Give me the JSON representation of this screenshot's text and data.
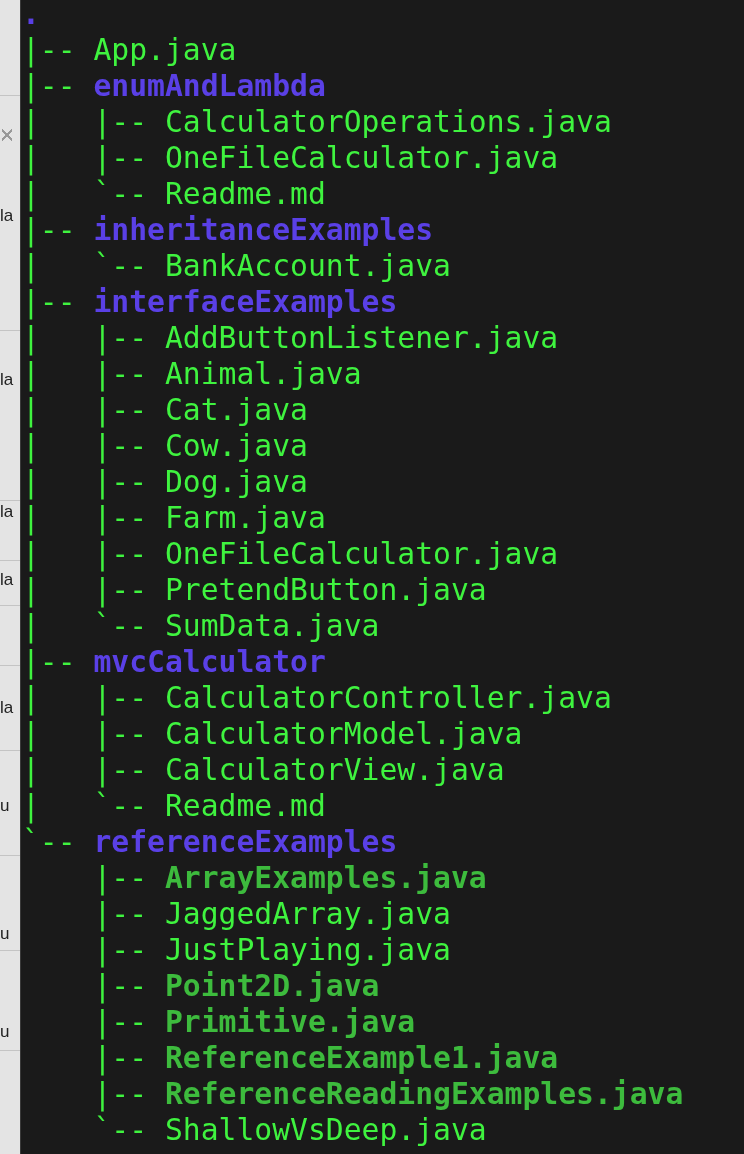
{
  "background_window": {
    "fragments": [
      "la",
      "la",
      "la",
      "la",
      "la",
      "u",
      "u",
      "u"
    ]
  },
  "terminal": {
    "root": ".",
    "items": [
      {
        "prefix": "|-- ",
        "name": "App.java",
        "kind": "file"
      },
      {
        "prefix": "|-- ",
        "name": "enumAndLambda",
        "kind": "dir",
        "children": [
          {
            "prefix": "|   |-- ",
            "name": "CalculatorOperations.java",
            "kind": "file"
          },
          {
            "prefix": "|   |-- ",
            "name": "OneFileCalculator.java",
            "kind": "file"
          },
          {
            "prefix": "|   `-- ",
            "name": "Readme.md",
            "kind": "file"
          }
        ]
      },
      {
        "prefix": "|-- ",
        "name": "inheritanceExamples",
        "kind": "dir",
        "children": [
          {
            "prefix": "|   `-- ",
            "name": "BankAccount.java",
            "kind": "file"
          }
        ]
      },
      {
        "prefix": "|-- ",
        "name": "interfaceExamples",
        "kind": "dir",
        "children": [
          {
            "prefix": "|   |-- ",
            "name": "AddButtonListener.java",
            "kind": "file"
          },
          {
            "prefix": "|   |-- ",
            "name": "Animal.java",
            "kind": "file"
          },
          {
            "prefix": "|   |-- ",
            "name": "Cat.java",
            "kind": "file"
          },
          {
            "prefix": "|   |-- ",
            "name": "Cow.java",
            "kind": "file"
          },
          {
            "prefix": "|   |-- ",
            "name": "Dog.java",
            "kind": "file"
          },
          {
            "prefix": "|   |-- ",
            "name": "Farm.java",
            "kind": "file"
          },
          {
            "prefix": "|   |-- ",
            "name": "OneFileCalculator.java",
            "kind": "file"
          },
          {
            "prefix": "|   |-- ",
            "name": "PretendButton.java",
            "kind": "file"
          },
          {
            "prefix": "|   `-- ",
            "name": "SumData.java",
            "kind": "file"
          }
        ]
      },
      {
        "prefix": "|-- ",
        "name": "mvcCalculator",
        "kind": "dir",
        "children": [
          {
            "prefix": "|   |-- ",
            "name": "CalculatorController.java",
            "kind": "file"
          },
          {
            "prefix": "|   |-- ",
            "name": "CalculatorModel.java",
            "kind": "file"
          },
          {
            "prefix": "|   |-- ",
            "name": "CalculatorView.java",
            "kind": "file"
          },
          {
            "prefix": "|   `-- ",
            "name": "Readme.md",
            "kind": "file"
          }
        ]
      },
      {
        "prefix": "`-- ",
        "name": "referenceExamples",
        "kind": "dir",
        "children": [
          {
            "prefix": "    |-- ",
            "name": "ArrayExamples.java",
            "kind": "boldfile"
          },
          {
            "prefix": "    |-- ",
            "name": "JaggedArray.java",
            "kind": "file"
          },
          {
            "prefix": "    |-- ",
            "name": "JustPlaying.java",
            "kind": "file"
          },
          {
            "prefix": "    |-- ",
            "name": "Point2D.java",
            "kind": "boldfile"
          },
          {
            "prefix": "    |-- ",
            "name": "Primitive.java",
            "kind": "boldfile"
          },
          {
            "prefix": "    |-- ",
            "name": "ReferenceExample1.java",
            "kind": "boldfile"
          },
          {
            "prefix": "    |-- ",
            "name": "ReferenceReadingExamples.java",
            "kind": "boldfile"
          },
          {
            "prefix": "    `-- ",
            "name": "ShallowVsDeep.java",
            "kind": "file"
          }
        ]
      }
    ]
  }
}
